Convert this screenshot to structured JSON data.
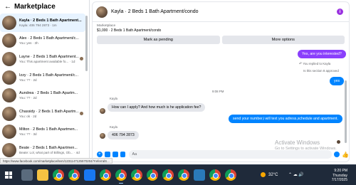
{
  "sidebar": {
    "title": "Marketplace",
    "conversations": [
      {
        "name": "Kayla · 2 Beds 1 Bath Apartment...",
        "sub": "Kayla: 406 794 2873 · 1m"
      },
      {
        "name": "Alex · 2 Beds 1 Bath Apartment/c...",
        "sub": "You: yes · 3h"
      },
      {
        "name": "Layne · 2 Beds 1 Bath Apartment...",
        "sub": "You: This apartment available fo... · 1d"
      },
      {
        "name": "Izzy · 2 Beds 1 Bath Apartment/c...",
        "sub": "You: ?? · 2d"
      },
      {
        "name": "Aundrea · 2 Beds 1 Bath Apartm...",
        "sub": "You: ?? · 2d"
      },
      {
        "name": "Chassidy · 2 Beds 1 Bath Apartm...",
        "sub": "You: ok · 2d"
      },
      {
        "name": "Milton · 2 Beds 1 Bath Apartmen...",
        "sub": "You: ?? · 3d"
      },
      {
        "name": "Beate · 2 Beds 1 Bath Apartmen...",
        "sub": "Beate: Lol, what part of Billings, Ob... · 4d"
      }
    ]
  },
  "chat": {
    "title": "Kayla · 2 Beds 1 Bath Apartment/condo",
    "listing_label": "Marketplace",
    "listing_price": "$1,000 · 2 Beds 1 Bath Apartment/condo",
    "mark_pending": "Mark as pending",
    "more_options": "More options",
    "messages": {
      "m1": "Yes, are you interested?",
      "replied_meta": "You replied to Kayla",
      "quoted": "Is this section 8 approved",
      "m2": "yes",
      "time": "9:08 PM",
      "sender1": "Kayla",
      "m3": "How can I apply? And how much is he application fee?",
      "m4": "send your number,i will text you adress,schedule and apartment.",
      "sender2": "Kayla",
      "m5": "406 794 2873"
    },
    "input_placeholder": "Aa",
    "watermark_title": "Activate Windows",
    "watermark_sub": "Go to Settings to activate Windows."
  },
  "statusbar": {
    "url": "https://www.facebook.com/marketplace/item/1231147125570204/?referralS..."
  },
  "taskbar": {
    "weather": "32°C",
    "time": "9:20 PM",
    "day": "Thursday",
    "date": "7/17/2025"
  }
}
